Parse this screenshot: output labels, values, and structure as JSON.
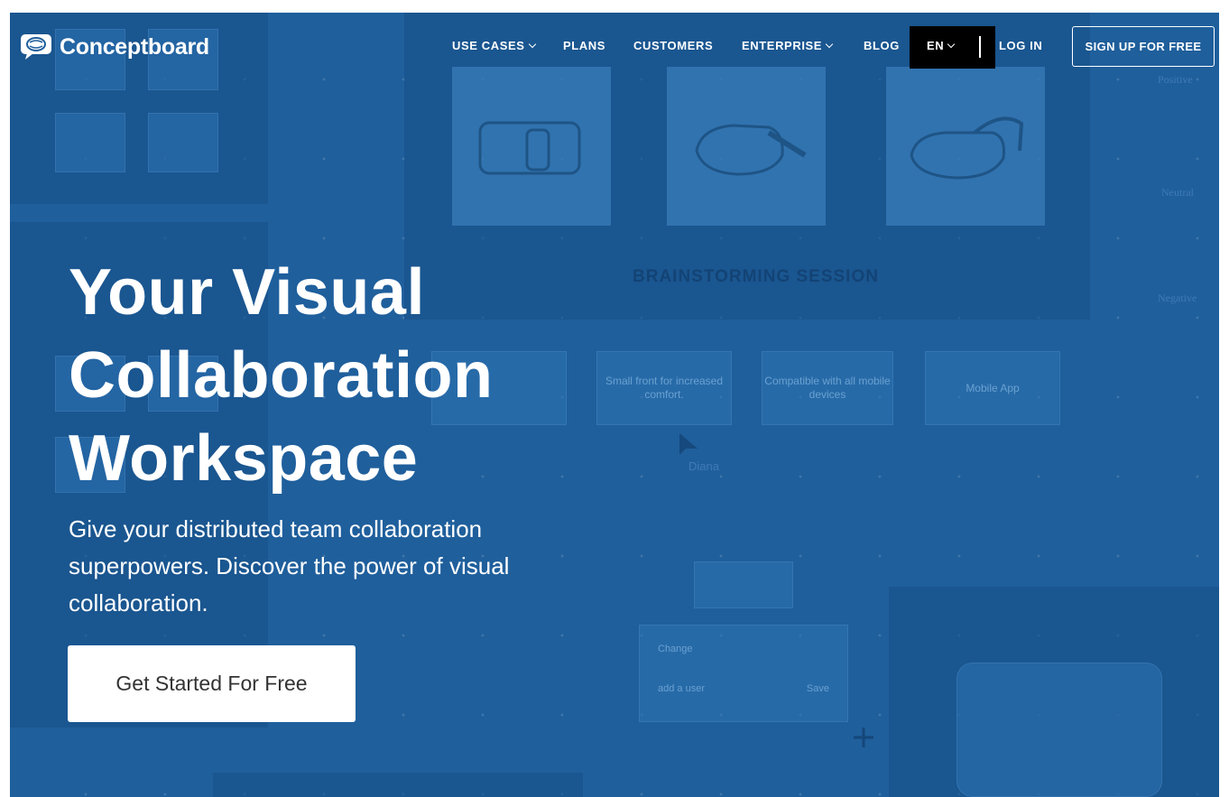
{
  "brand": {
    "name": "Conceptboard"
  },
  "nav": {
    "use_cases": "USE CASES",
    "plans": "PLANS",
    "customers": "CUSTOMERS",
    "enterprise": "ENTERPRISE",
    "blog": "BLOG",
    "language": "EN",
    "login": "LOG IN",
    "signup": "SIGN UP FOR FREE"
  },
  "hero": {
    "title": "Your Visual Collaboration Workspace",
    "subtitle": "Give your distributed team collaboration superpowers. Discover the power of visual collaboration.",
    "cta": "Get Started For Free"
  },
  "background_board": {
    "session_label": "BRAINSTORMING SESSION",
    "cards": [
      "Small front for increased comfort.",
      "Compatible with all mobile devices",
      "Mobile App"
    ],
    "sentiment": [
      "Positive",
      "Neutral",
      "Negative"
    ],
    "cursor_name": "Diana",
    "comment_text": "Change",
    "add_user": "add a user",
    "save": "Save"
  },
  "colors": {
    "hero_bg": "#1f5f9c",
    "highlight_box": "#000000"
  },
  "icons": [
    "chat-logo-icon",
    "chevron-down-icon",
    "vr-headset-icon",
    "cursor-arrow-icon",
    "move-icon"
  ]
}
